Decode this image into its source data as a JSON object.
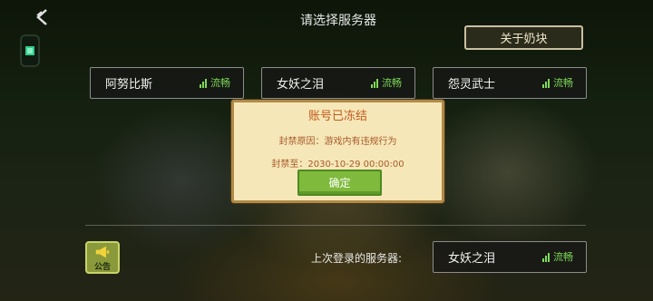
{
  "header": {
    "title": "请选择服务器",
    "about_label": "关于奶块"
  },
  "servers": [
    {
      "name": "阿努比斯",
      "status": "流畅"
    },
    {
      "name": "女妖之泪",
      "status": "流畅"
    },
    {
      "name": "怨灵武士",
      "status": "流畅"
    }
  ],
  "footer": {
    "notice_label": "公告",
    "last_login_label": "上次登录的服务器:",
    "last_server": {
      "name": "女妖之泪",
      "status": "流畅"
    }
  },
  "modal": {
    "title": "账号已冻结",
    "reason": "封禁原因：游戏内有违规行为",
    "until": "封禁至：2030-10-29 00:00:00",
    "confirm_label": "确定"
  },
  "colors": {
    "status_green": "#7ed957",
    "modal_bg": "#f6e7b8",
    "modal_title": "#c1591c",
    "confirm_green": "#7fba3c"
  }
}
